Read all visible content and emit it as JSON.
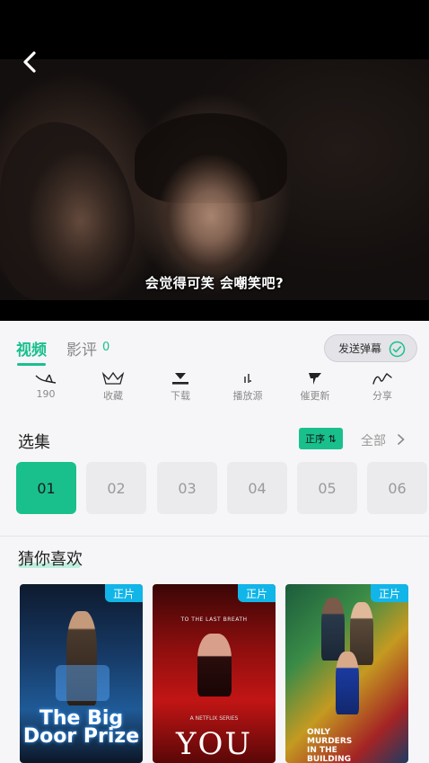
{
  "video": {
    "subtitle": "会觉得可笑 会嘲笑吧?"
  },
  "tabs": {
    "video_label": "视频",
    "review_label": "影评",
    "review_count": "0",
    "danmaku_label": "发送弹幕"
  },
  "actions": [
    {
      "label": "190",
      "icon": "like-icon"
    },
    {
      "label": "收藏",
      "icon": "favorite-icon"
    },
    {
      "label": "下载",
      "icon": "download-icon"
    },
    {
      "label": "播放源",
      "icon": "source-icon"
    },
    {
      "label": "催更新",
      "icon": "urge-update-icon"
    },
    {
      "label": "分享",
      "icon": "share-icon"
    }
  ],
  "episodes": {
    "title": "选集",
    "order_label": "正序 ⇅",
    "all_label": "全部",
    "items": [
      "01",
      "02",
      "03",
      "04",
      "05",
      "06"
    ],
    "selected": "01"
  },
  "recommend": {
    "title": "猜你喜欢",
    "items": [
      {
        "badge": "正片",
        "poster_title": "The Big Door Prize"
      },
      {
        "badge": "正片",
        "poster_title": "YOU",
        "tagline": "TO THE LAST BREATH",
        "network": "A NETFLIX SERIES"
      },
      {
        "badge": "正片",
        "poster_title": "ONLY MURDERS IN THE BUILDING"
      }
    ]
  },
  "colors": {
    "accent": "#19c08c",
    "badge": "#12b5e8"
  }
}
